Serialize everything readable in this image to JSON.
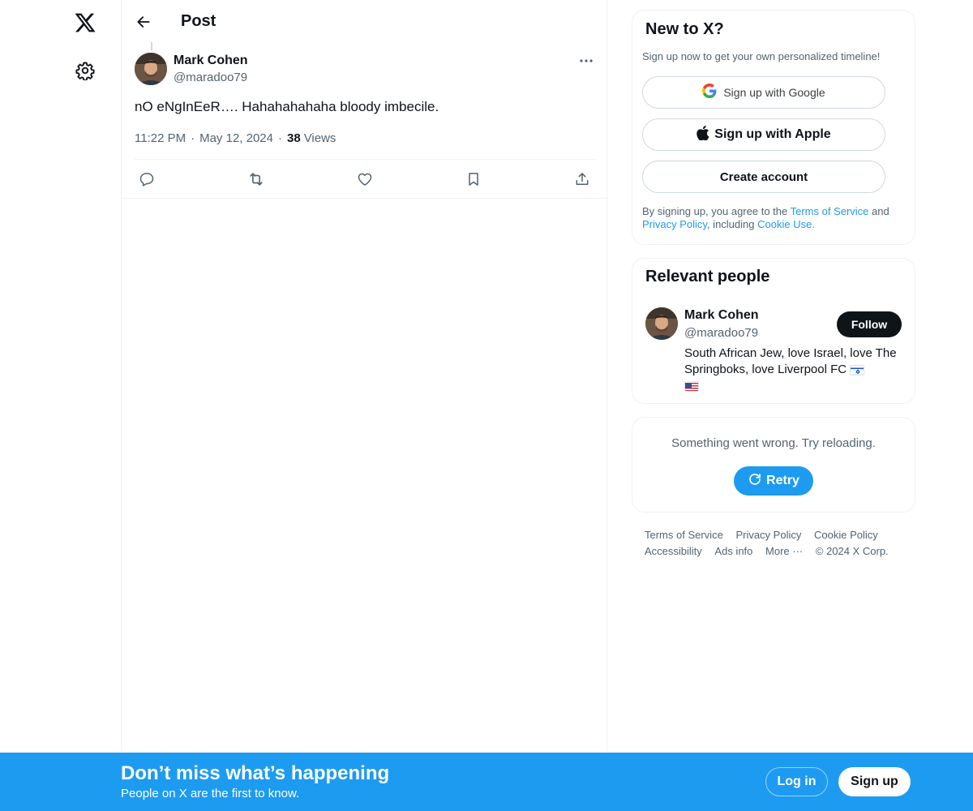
{
  "nav": {
    "logo_icon": "x-logo-icon",
    "settings_icon": "gear-icon"
  },
  "header": {
    "title": "Post",
    "back_icon": "arrow-left-icon"
  },
  "post": {
    "author_name": "Mark Cohen",
    "author_handle": "@maradoo79",
    "text": "nO eNgInEeR…. Hahahahahaha bloody imbecile.",
    "time": "11:22 PM",
    "date": "May 12, 2024",
    "views_count": "38",
    "views_label": "Views",
    "actions": [
      "reply-icon",
      "repost-icon",
      "like-icon",
      "bookmark-icon",
      "share-icon"
    ]
  },
  "signup_card": {
    "title": "New to X?",
    "subtitle": "Sign up now to get your own personalized timeline!",
    "google_label": "Sign up with Google",
    "apple_label": "Sign up with Apple",
    "create_label": "Create account",
    "legal_prefix": "By signing up, you agree to the ",
    "terms_link": "Terms of Service",
    "legal_and": " and ",
    "privacy_link": "Privacy Policy",
    "legal_including": ", including ",
    "cookie_link": "Cookie Use."
  },
  "relevant_people": {
    "title": "Relevant people",
    "name": "Mark Cohen",
    "handle": "@maradoo79",
    "follow_label": "Follow",
    "bio": "South African Jew, love Israel, love The Springboks, love Liverpool FC"
  },
  "error_card": {
    "message": "Something went wrong. Try reloading.",
    "retry_label": "Retry"
  },
  "footer": {
    "links": [
      "Terms of Service",
      "Privacy Policy",
      "Cookie Policy",
      "Accessibility",
      "Ads info",
      "More ···"
    ],
    "copyright": "© 2024 X Corp."
  },
  "bottom_bar": {
    "title": "Don’t miss what’s happening",
    "subtitle": "People on X are the first to know.",
    "login_label": "Log in",
    "signup_label": "Sign up"
  },
  "colors": {
    "accent": "#1d9bf0",
    "text": "#0f1419",
    "muted": "#536471",
    "border": "#eff3f4"
  }
}
